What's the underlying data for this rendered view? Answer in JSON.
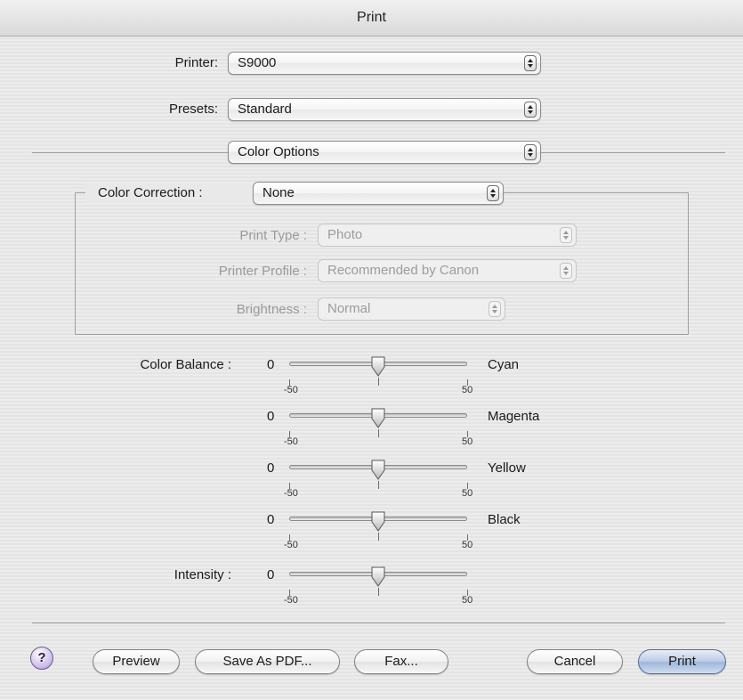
{
  "window": {
    "title": "Print"
  },
  "printer": {
    "label": "Printer:",
    "value": "S9000"
  },
  "presets": {
    "label": "Presets:",
    "value": "Standard"
  },
  "panel": {
    "value": "Color Options"
  },
  "color_correction": {
    "label": "Color Correction :",
    "value": "None",
    "print_type": {
      "label": "Print Type :",
      "value": "Photo"
    },
    "printer_profile": {
      "label": "Printer Profile :",
      "value": "Recommended by Canon"
    },
    "brightness": {
      "label": "Brightness :",
      "value": "Normal"
    }
  },
  "color_balance": {
    "label": "Color Balance :",
    "sliders": [
      {
        "value": "0",
        "name": "Cyan",
        "min": "-50",
        "max": "50",
        "level": 0
      },
      {
        "value": "0",
        "name": "Magenta",
        "min": "-50",
        "max": "50",
        "level": 0
      },
      {
        "value": "0",
        "name": "Yellow",
        "min": "-50",
        "max": "50",
        "level": 0
      },
      {
        "value": "0",
        "name": "Black",
        "min": "-50",
        "max": "50",
        "level": 0
      }
    ]
  },
  "intensity": {
    "label": "Intensity :",
    "value": "0",
    "min": "-50",
    "max": "50",
    "level": 0
  },
  "buttons": {
    "help": "?",
    "preview": "Preview",
    "save_pdf": "Save As PDF...",
    "fax": "Fax...",
    "cancel": "Cancel",
    "print": "Print"
  }
}
